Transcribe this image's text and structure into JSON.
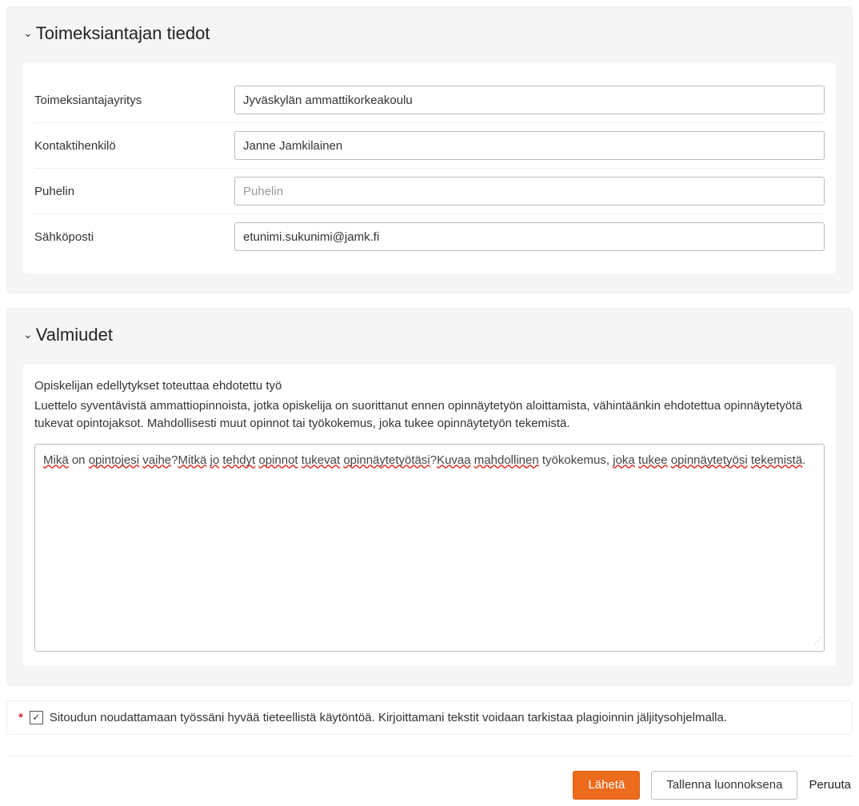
{
  "panel1": {
    "title": "Toimeksiantajan tiedot",
    "fields": {
      "company": {
        "label": "Toimeksiantajayritys",
        "value": "Jyväskylän ammattikorkeakoulu"
      },
      "contact": {
        "label": "Kontaktihenkilö",
        "value": "Janne Jamkilainen"
      },
      "phone": {
        "label": "Puhelin",
        "value": "",
        "placeholder": "Puhelin"
      },
      "email": {
        "label": "Sähköposti",
        "value": "etunimi.sukunimi@jamk.fi"
      }
    }
  },
  "panel2": {
    "title": "Valmiudet",
    "heading": "Opiskelijan edellytykset toteuttaa ehdotettu työ",
    "description": "Luettelo syventävistä ammattiopinnoista, jotka opiskelija on suorittanut ennen opinnäytetyön aloittamista, vähintäänkin ehdotettua opinnäytetyötä tukevat opintojaksot. Mahdollisesti muut opinnot tai työkokemus, joka tukee opinnäytetyön tekemistä.",
    "textarea_value": "Mikä on opintojesi vaihe?\nMitkä jo tehdyt opinnot tukevat opinnäytetyötäsi?\nKuvaa mahdollinen työkokemus, joka tukee opinnäytetyösi tekemistä.",
    "line1_parts": [
      "Mikä",
      " on ",
      "opintojesi",
      " ",
      "vaihe",
      "?"
    ],
    "line2_parts": [
      "Mitkä",
      " ",
      "jo",
      " ",
      "tehdyt",
      " ",
      "opinnot",
      " ",
      "tukevat",
      " ",
      "opinnäytetyötäsi",
      "?"
    ],
    "line3_parts": [
      "Kuvaa",
      " ",
      "mahdollinen",
      " työkokemus, ",
      "joka",
      " ",
      "tukee",
      " ",
      "opinnäytetyösi",
      " ",
      "tekemistä",
      "."
    ]
  },
  "commitment": {
    "text": "Sitoudun noudattamaan työssäni hyvää tieteellistä käytöntöä. Kirjoittamani tekstit voidaan tarkistaa plagioinnin jäljitysohjelmalla.",
    "checked": true
  },
  "buttons": {
    "submit": "Lähetä",
    "draft": "Tallenna luonnoksena",
    "cancel": "Peruuta"
  }
}
